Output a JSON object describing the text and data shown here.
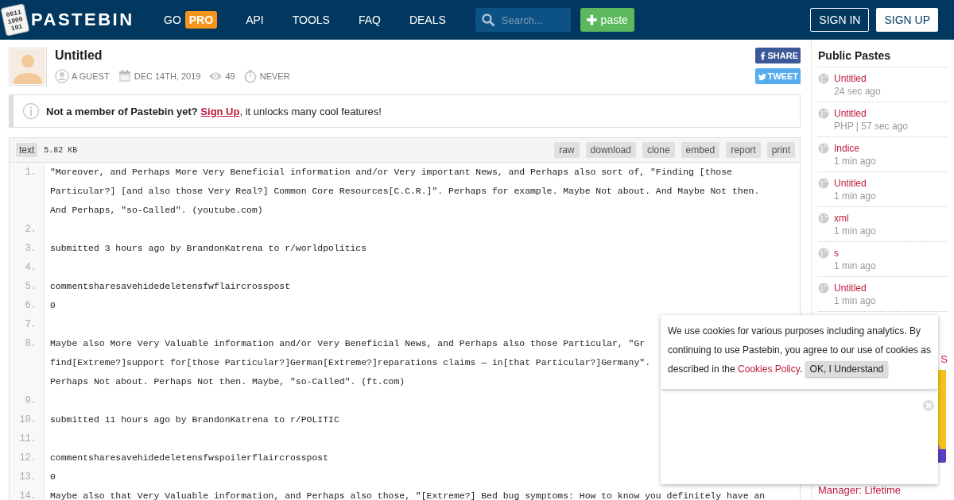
{
  "header": {
    "logo_digits": [
      "0011",
      "1000",
      "101"
    ],
    "logo_text": "PASTEBIN",
    "nav": [
      {
        "label": "GO",
        "badge": "PRO"
      },
      {
        "label": "API"
      },
      {
        "label": "TOOLS"
      },
      {
        "label": "FAQ"
      },
      {
        "label": "DEALS"
      }
    ],
    "search": {
      "placeholder": "Search..."
    },
    "paste_button": "paste",
    "sign_in": "SIGN IN",
    "sign_up": "SIGN UP"
  },
  "paste": {
    "title": "Untitled",
    "author": "A GUEST",
    "date": "DEC 14TH, 2019",
    "views": "49",
    "expires": "NEVER",
    "share": [
      {
        "kind": "facebook",
        "label": "SHARE"
      },
      {
        "kind": "twitter",
        "label": "TWEET"
      }
    ]
  },
  "notice": {
    "lead": "Not a member of Pastebin yet?",
    "link": "Sign Up",
    "rest": ", it unlocks many cool features!"
  },
  "toolbar": {
    "format": "text",
    "size": "5.82 KB",
    "actions": [
      "raw",
      "download",
      "clone",
      "embed",
      "report",
      "print"
    ]
  },
  "code": [
    {
      "number": "1.",
      "lines": [
        "\"Moreover, and Perhaps More Very Beneficial information and/or Very important News, and Perhaps also sort of, \"Finding [those",
        "Particular?] [and also those Very Real?] Common Core Resources[C.C.R.]\". Perhaps for example. Maybe Not about. And Maybe Not then.",
        "And Perhaps, \"so-Called\". (youtube.com)"
      ]
    },
    {
      "number": "2."
    },
    {
      "number": "3.",
      "lines": [
        "submitted 3 hours ago by BrandonKatrena to r/worldpolitics"
      ]
    },
    {
      "number": "4."
    },
    {
      "number": "5.",
      "lines": [
        "commentsharesavehidedeletensfwflaircrosspost"
      ]
    },
    {
      "number": "6.",
      "lines": [
        "0"
      ]
    },
    {
      "number": "7."
    },
    {
      "number": "8.",
      "lines": [
        "Maybe also More Very Valuable information and/or Very Beneficial News, and Perhaps also those Particular, \"Gr",
        "find[Extreme?]support for[those Particular?]German[Extreme?]reparations claims — in[that Particular?]Germany\".",
        "Perhaps Not about. Perhaps Not then. Maybe, \"so-Called\". (ft.com)"
      ]
    },
    {
      "number": "9."
    },
    {
      "number": "10.",
      "lines": [
        "submitted 11 hours ago by BrandonKatrena to r/POLITIC"
      ]
    },
    {
      "number": "11."
    },
    {
      "number": "12.",
      "lines": [
        "commentsharesavehidedeletensfwspoilerflaircrosspost"
      ]
    },
    {
      "number": "13.",
      "lines": [
        "0"
      ]
    },
    {
      "number": "14.",
      "lines": [
        "Maybe also that Very Valuable information, and Perhaps also those, \"[Extreme?] Bed bug symptoms: How to know you definitely have an"
      ]
    }
  ],
  "sidebar": {
    "title": "Public Pastes",
    "items": [
      {
        "title": "Untitled",
        "meta": "24 sec ago"
      },
      {
        "title": "Untitled",
        "meta": "PHP | 57 sec ago"
      },
      {
        "title": "Indice",
        "meta": "1 min ago"
      },
      {
        "title": "Untitled",
        "meta": "1 min ago"
      },
      {
        "title": "xml",
        "meta": "1 min ago"
      },
      {
        "title": "s",
        "meta": "1 min ago"
      },
      {
        "title": "Untitled",
        "meta": "1 min ago"
      }
    ],
    "ad": {
      "heading": "S",
      "kind": "picture",
      "caption": "Manager: Lifetime"
    }
  },
  "cookie": {
    "text": "We use cookies for various purposes including analytics. By continuing to use Pastebin, you agree to our use of cookies as described in the ",
    "link": "Cookies Policy",
    "after": ".",
    "button": "OK, I Understand"
  }
}
